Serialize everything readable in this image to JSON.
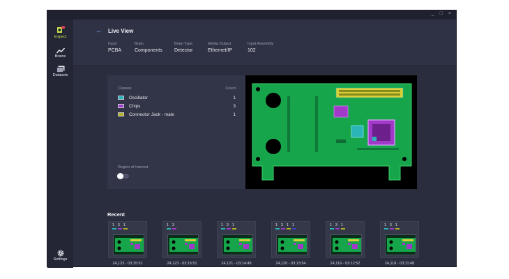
{
  "sidebar": {
    "items": [
      {
        "label": "Inspect",
        "icon": "inspect-icon"
      },
      {
        "label": "Brains",
        "icon": "chart-line-icon"
      },
      {
        "label": "Datasets",
        "icon": "images-icon"
      }
    ],
    "settings_label": "Settings",
    "active_color": "#c8e04a"
  },
  "window_controls": {
    "minimize": "_",
    "maximize": "□",
    "close": "×"
  },
  "header": {
    "title": "Live View",
    "fields": [
      {
        "key": "Input",
        "value": "PCBA"
      },
      {
        "key": "Brain",
        "value": "Components"
      },
      {
        "key": "Brain Type",
        "value": "Detector"
      },
      {
        "key": "Media Output",
        "value": "Ethernet/IP"
      },
      {
        "key": "Input Assembly",
        "value": "102"
      }
    ]
  },
  "classes": {
    "header": "Classes",
    "count_header": "Count",
    "items": [
      {
        "name": "Oscillator",
        "count": "1",
        "color": "#2bb5b8"
      },
      {
        "name": "Chips",
        "count": "3",
        "color": "#a23ac9"
      },
      {
        "name": "Connector Jack - male",
        "count": "1",
        "color": "#b5b322"
      }
    ]
  },
  "roi": {
    "label": "Region of Interest",
    "enabled": false
  },
  "recent": {
    "title": "Recent",
    "cards": [
      {
        "counts": [
          "1",
          "3",
          "1"
        ],
        "label": "24,123 - 03:15:51"
      },
      {
        "counts": [
          "1",
          "3"
        ],
        "label": "24,123 - 03:15:51"
      },
      {
        "counts": [
          "1",
          "3",
          "1"
        ],
        "label": "24,121 - 03:14:49"
      },
      {
        "counts": [
          "1",
          "3",
          "1",
          "1"
        ],
        "label": "24,120 - 03:13:54"
      },
      {
        "counts": [
          "1",
          "3",
          "1"
        ],
        "label": "24,119 - 03:12:52"
      },
      {
        "counts": [
          "1",
          "3",
          "1"
        ],
        "label": "24,118 - 03:11:48"
      }
    ]
  }
}
